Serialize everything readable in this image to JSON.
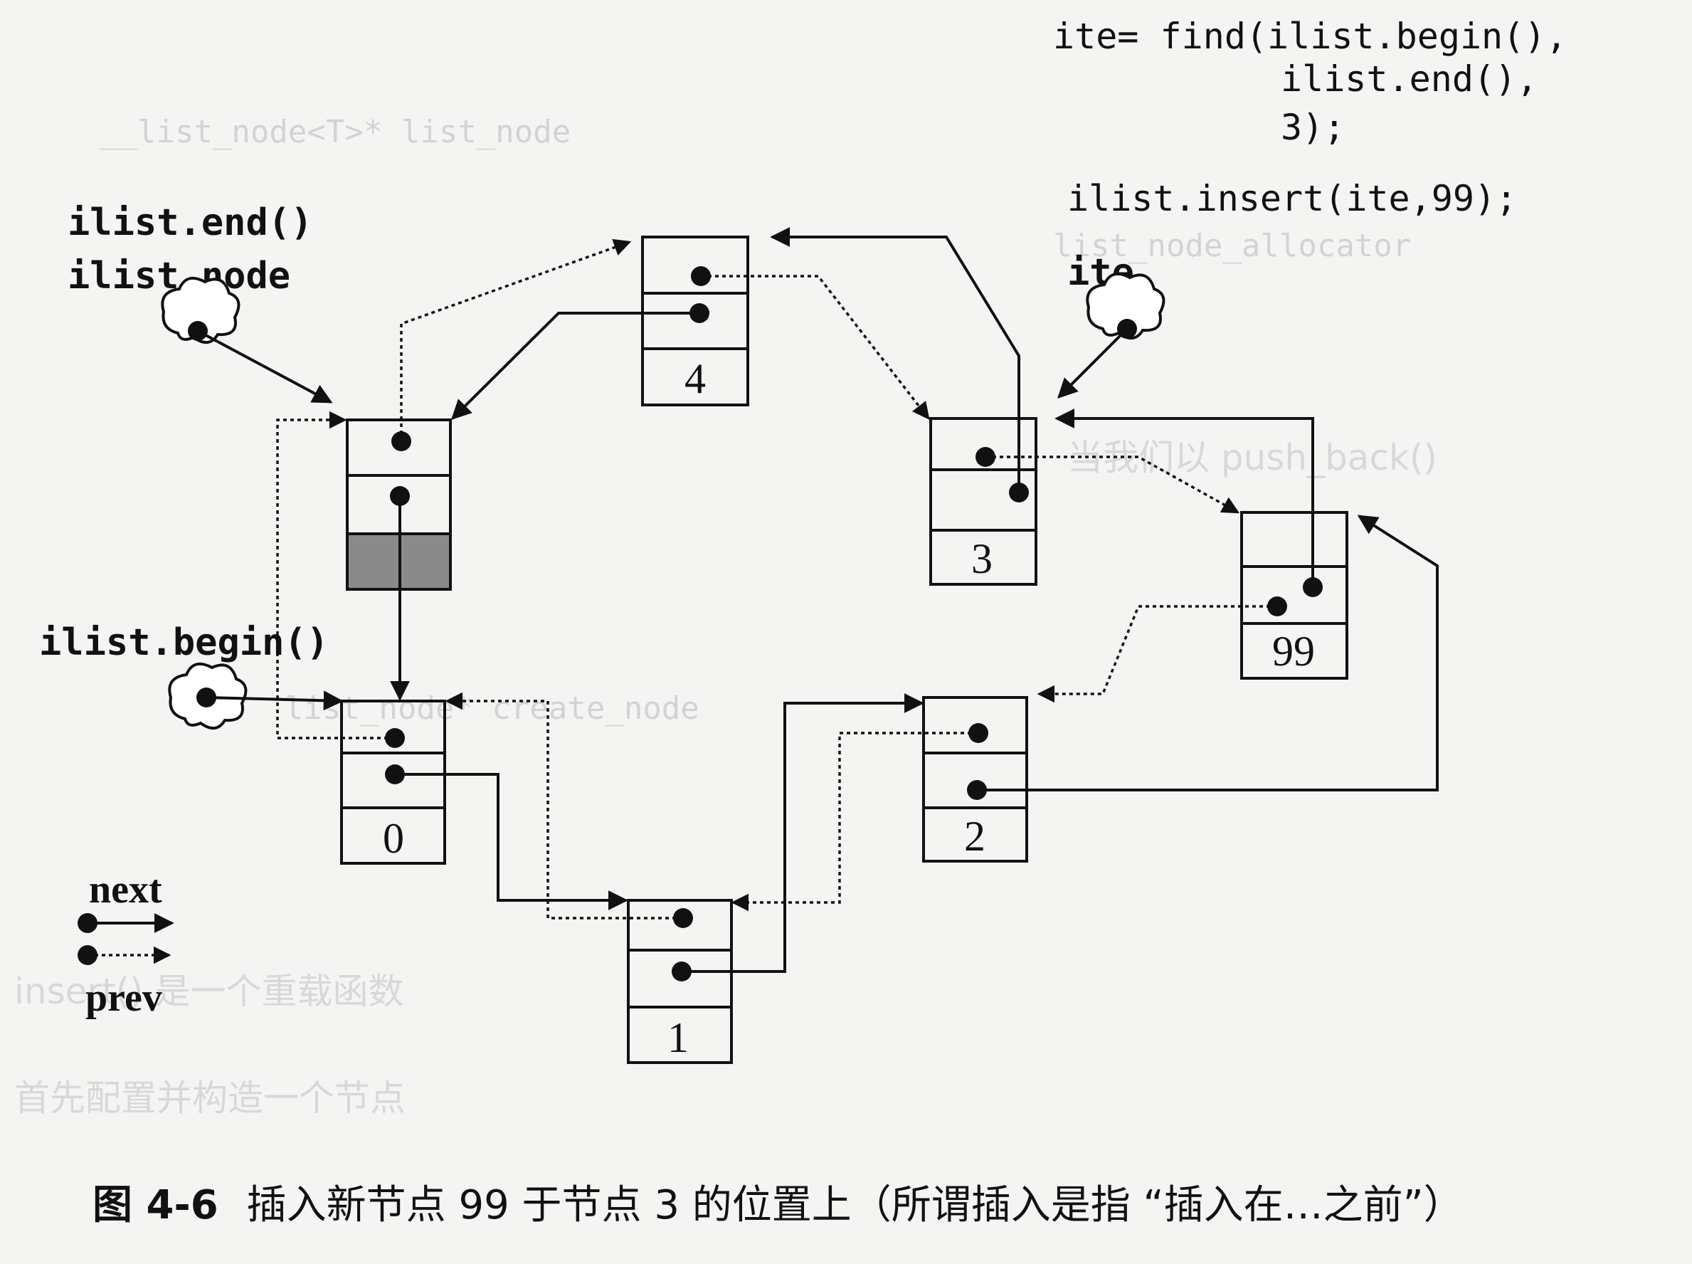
{
  "code": {
    "line1": "ite= find(ilist.begin(),",
    "line2": "ilist.end(),",
    "line3": "3);",
    "line4": "ilist.insert(ite,99);"
  },
  "labels": {
    "end": "ilist.end()",
    "node": "ilist.node",
    "ite": "ite",
    "begin": "ilist.begin()"
  },
  "nodes": [
    {
      "id": "empty",
      "value": ""
    },
    {
      "id": "n0",
      "value": "0"
    },
    {
      "id": "n1",
      "value": "1"
    },
    {
      "id": "n2",
      "value": "2"
    },
    {
      "id": "n3",
      "value": "3"
    },
    {
      "id": "n4",
      "value": "4"
    },
    {
      "id": "n99",
      "value": "99"
    }
  ],
  "legend": {
    "next": "next",
    "prev": "prev"
  },
  "caption": {
    "figure": "图 4-6",
    "text": "插入新节点 99 于节点 3 的位置上（所谓插入是指 “插入在…之前”）"
  }
}
